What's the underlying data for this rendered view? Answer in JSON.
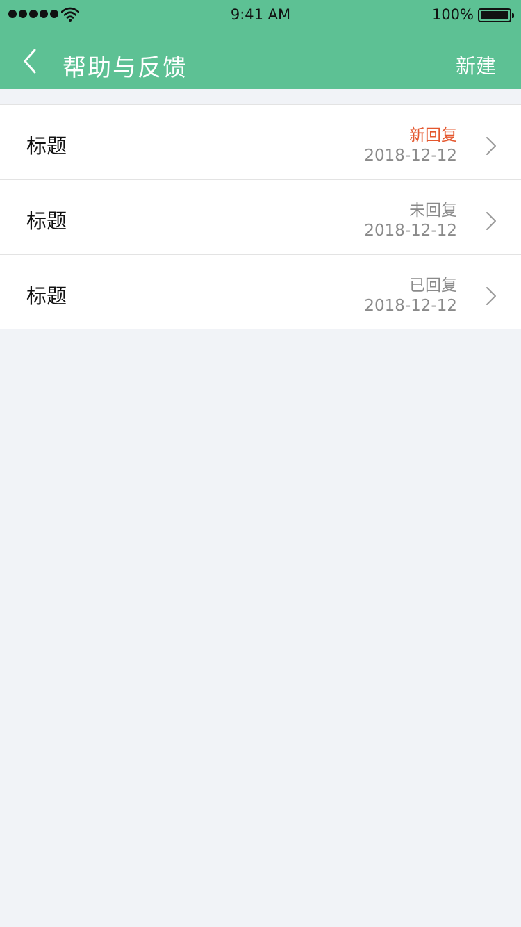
{
  "status_bar": {
    "time": "9:41 AM",
    "battery": "100%",
    "icons": [
      "signal-dots",
      "wifi-icon",
      "battery-icon"
    ]
  },
  "nav": {
    "back_icon": "chevron-left-icon",
    "title": "帮助与反馈",
    "new_label": "新建"
  },
  "items": [
    {
      "title": "标题",
      "status": "新回复",
      "date": "2018-12-12",
      "highlight": true
    },
    {
      "title": "标题",
      "status": "未回复",
      "date": "2018-12-12",
      "highlight": false
    },
    {
      "title": "标题",
      "status": "已回复",
      "date": "2018-12-12",
      "highlight": false
    }
  ],
  "colors": {
    "header_bg": "#5dc194",
    "page_bg": "#f1f3f7",
    "new_reply": "#e4572e",
    "muted_text": "#8a8a8a"
  }
}
